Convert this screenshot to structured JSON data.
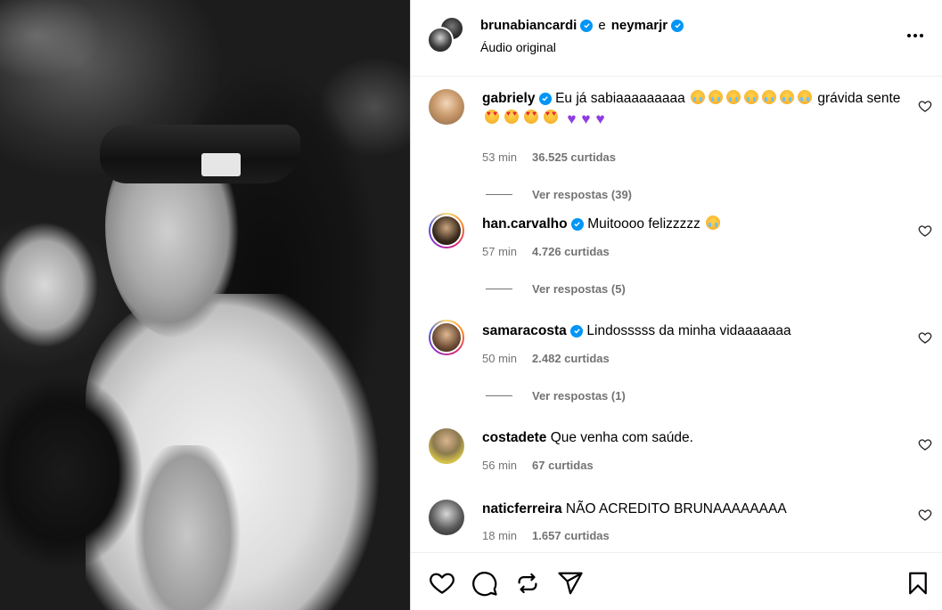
{
  "header": {
    "user1": "brunabiancardi",
    "conjunction": "e",
    "user2": "neymarjr",
    "audio": "Áudio original",
    "more_icon": "more-horizontal-icon"
  },
  "comments": [
    {
      "user": "gabriely",
      "verified": true,
      "text_prefix": "Eu já sabiaaaaaaaaa",
      "text_mid": "grávida sente",
      "time": "53 min",
      "likes": "36.525 curtidas",
      "replies": "Ver respostas (39)"
    },
    {
      "user": "han.carvalho",
      "verified": true,
      "text": "Muitoooo felizzzzz",
      "time": "57 min",
      "likes": "4.726 curtidas",
      "replies": "Ver respostas (5)"
    },
    {
      "user": "samaracosta",
      "verified": true,
      "text": "Lindosssss da minha vidaaaaaaa",
      "time": "50 min",
      "likes": "2.482 curtidas",
      "replies": "Ver respostas (1)"
    },
    {
      "user": "costadete",
      "verified": false,
      "text": "Que venha com saúde.",
      "time": "56 min",
      "likes": "67 curtidas"
    },
    {
      "user": "naticferreira",
      "verified": false,
      "text": "NÃO ACREDITO BRUNAAAAAAAA",
      "time": "18 min",
      "likes": "1.657 curtidas"
    }
  ],
  "actions": [
    "heart-icon",
    "comment-icon",
    "repost-icon",
    "share-icon",
    "bookmark-icon"
  ],
  "colors": {
    "verified": "#0095f6",
    "meta": "#737373",
    "divider": "#dbdbdb"
  }
}
